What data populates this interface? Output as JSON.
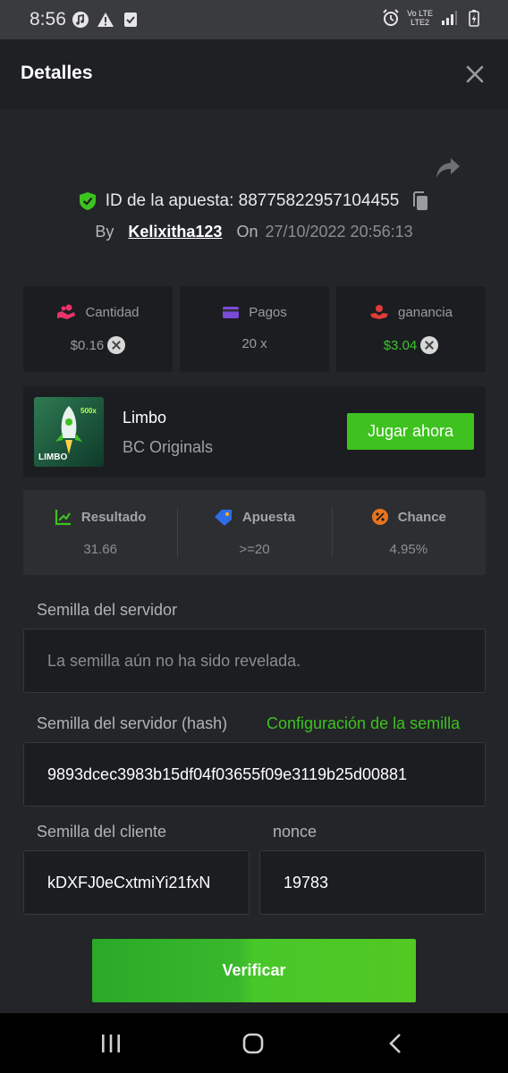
{
  "status_bar": {
    "time": "8:56",
    "network_label_top": "Vo LTE",
    "network_label_bottom": "LTE2",
    "icons": [
      "music-icon",
      "warning-icon",
      "checkbox-icon",
      "alarm-icon",
      "signal-icon",
      "battery-icon"
    ]
  },
  "header": {
    "title": "Detalles",
    "close_icon": "close-icon"
  },
  "bet": {
    "id_label": "ID de la apuesta: 88775822957104455",
    "by_label": "By",
    "username": "Kelixitha123",
    "on_label": "On",
    "date": "27/10/2022 20:56:13"
  },
  "stats": [
    {
      "label": "Cantidad",
      "value": "$0.16",
      "icon": "hand-coins-icon",
      "icon_color": "#e8336b"
    },
    {
      "label": "Pagos",
      "value": "20 x",
      "icon": "wallet-icon",
      "icon_color": "#7b4bd8"
    },
    {
      "label": "ganancia",
      "value": "$3.04",
      "icon": "profit-hand-icon",
      "icon_color": "#e23b3b"
    }
  ],
  "game": {
    "name": "Limbo",
    "provider": "BC Originals",
    "play_label": "Jugar ahora",
    "thumb_badge": "500x",
    "thumb_text": "LIMBO"
  },
  "result": [
    {
      "label": "Resultado",
      "value": "31.66",
      "icon": "chart-up-icon",
      "icon_color": "#3dc21f"
    },
    {
      "label": "Apuesta",
      "value": ">=20",
      "icon": "tag-icon",
      "icon_color": "#2f6de8"
    },
    {
      "label": "Chance",
      "value": "4.95%",
      "icon": "percent-icon",
      "icon_color": "#e8741e"
    }
  ],
  "seeds": {
    "server_seed_label": "Semilla del servidor",
    "server_seed_value": "La semilla aún no ha sido revelada.",
    "server_hash_label": "Semilla del servidor (hash)",
    "config_link": "Configuración de la semilla",
    "server_hash_value": "9893dcec3983b15df04f03655f09e3119b25d00881",
    "client_seed_label": "Semilla del cliente",
    "client_seed_value": "kDXFJ0eCxtmiYi21fxN",
    "nonce_label": "nonce",
    "nonce_value": "19783"
  },
  "verify_label": "Verificar",
  "colors": {
    "accent_green": "#3dc21f",
    "background": "#232528",
    "card": "#1b1d20"
  }
}
